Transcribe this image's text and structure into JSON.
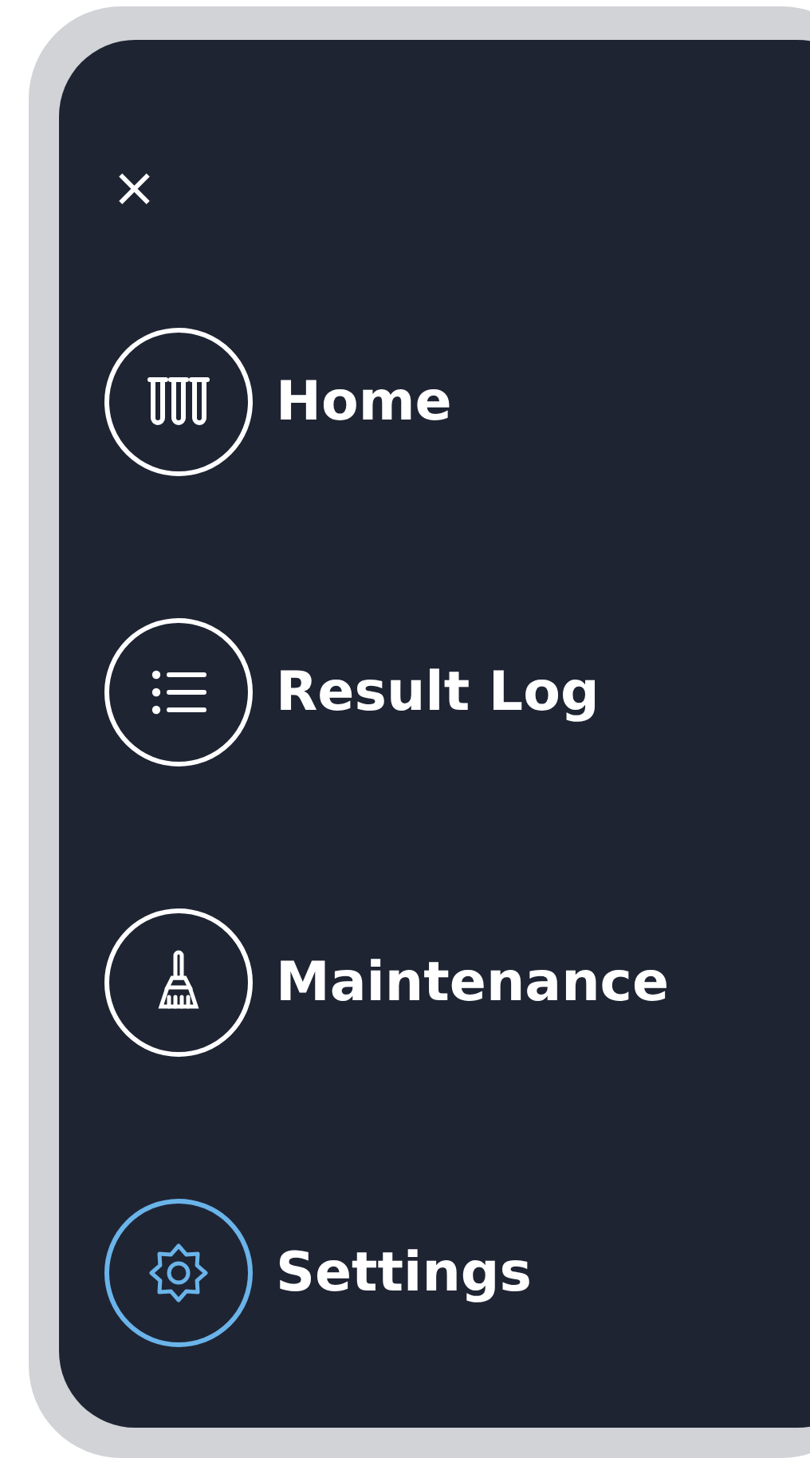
{
  "close_button": {
    "label": "×"
  },
  "menu": {
    "items": [
      {
        "kind": "tubes",
        "label": "Home",
        "selected": false
      },
      {
        "kind": "list",
        "label": "Result Log",
        "selected": false
      },
      {
        "kind": "broom",
        "label": "Maintenance",
        "selected": false
      },
      {
        "kind": "gear",
        "label": "Settings",
        "selected": true
      }
    ]
  }
}
